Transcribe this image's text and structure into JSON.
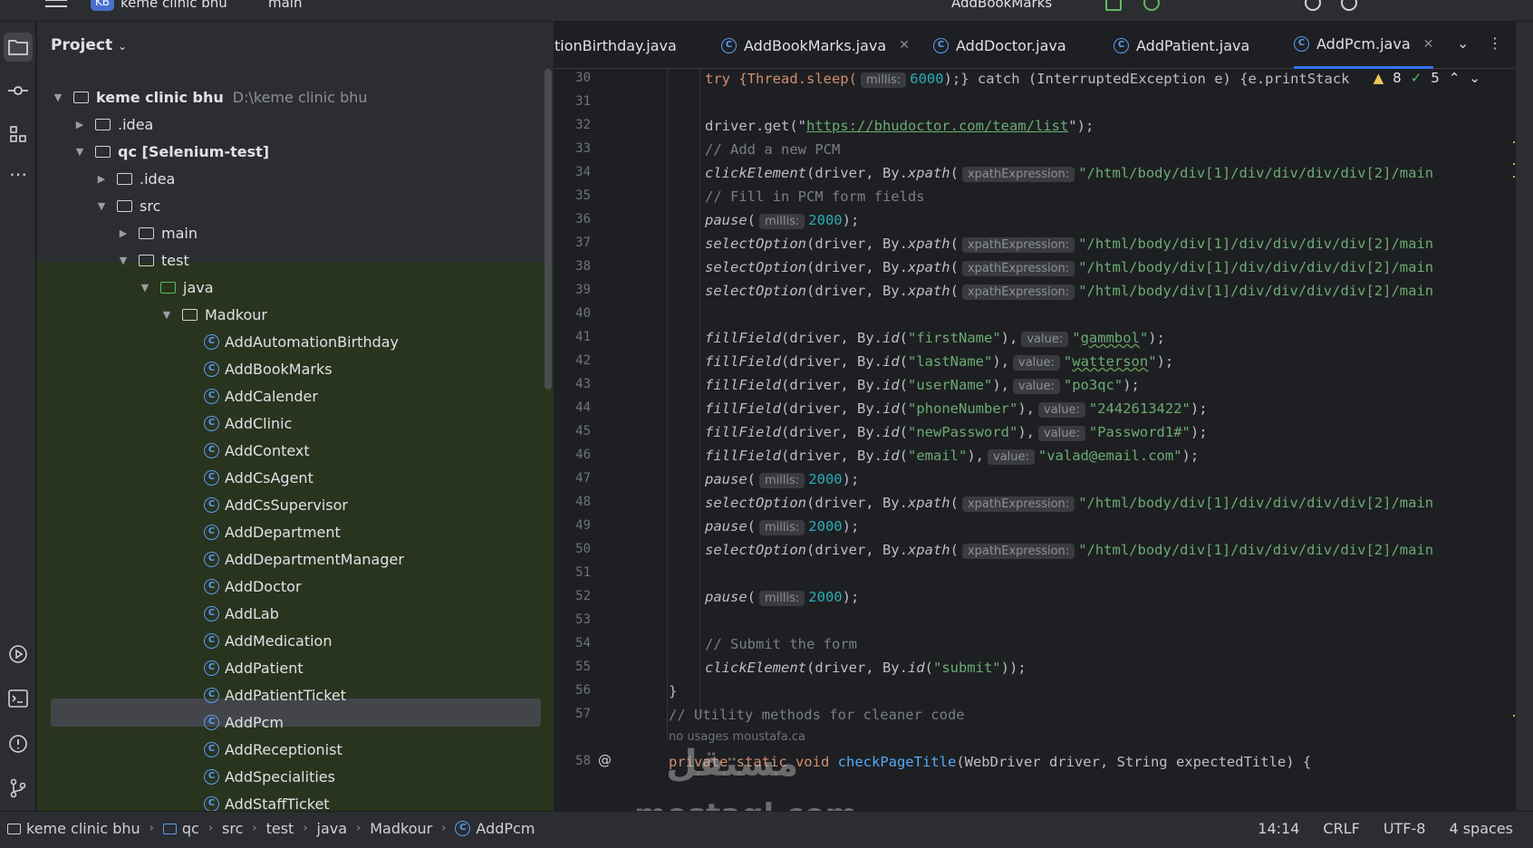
{
  "topbar": {
    "project_badge": "KB",
    "project_name": "keme clinic bhu",
    "branch": "main",
    "run_config": "AddBookMarks"
  },
  "project_panel": {
    "title": "Project",
    "tree": [
      {
        "label": "keme clinic bhu",
        "path": "D:\\keme clinic bhu"
      },
      {
        "label": ".idea"
      },
      {
        "label": "qc [Selenium-test]"
      },
      {
        "label": ".idea"
      },
      {
        "label": "src"
      },
      {
        "label": "main"
      },
      {
        "label": "test"
      },
      {
        "label": "java"
      },
      {
        "label": "Madkour"
      }
    ],
    "classes": [
      "AddAutomationBirthday",
      "AddBookMarks",
      "AddCalender",
      "AddClinic",
      "AddContext",
      "AddCsAgent",
      "AddCsSupervisor",
      "AddDepartment",
      "AddDepartmentManager",
      "AddDoctor",
      "AddLab",
      "AddMedication",
      "AddPatient",
      "AddPatientTicket",
      "AddPcm",
      "AddReceptionist",
      "AddSpecialities",
      "AddStaffTicket"
    ]
  },
  "tabs": [
    {
      "label": "tionBirthday.java"
    },
    {
      "label": "AddBookMarks.java"
    },
    {
      "label": "AddDoctor.java"
    },
    {
      "label": "AddPatient.java"
    },
    {
      "label": "AddPcm.java"
    }
  ],
  "inspections": {
    "warnings": "8",
    "ok": "5"
  },
  "code": {
    "l30": {
      "n": "30",
      "a": "try {Thread.sleep(",
      "hint": "millis:",
      "num": "6000",
      "b": ");} catch (InterruptedException e) {e.printStack"
    },
    "l31": {
      "n": "31"
    },
    "l32": {
      "n": "32",
      "a": "driver.get(\"",
      "url": "https://bhudoctor.com/team/list",
      "b": "\");"
    },
    "l33": {
      "n": "33",
      "cm": "// Add a new PCM"
    },
    "l34": {
      "n": "34",
      "m": "clickElement",
      "a": "(driver, By.",
      "m2": "xpath",
      "hint": "xpathExpression:",
      "s": "\"/html/body/div[1]/div/div/div/div[2]/main"
    },
    "l35": {
      "n": "35",
      "cm": "// Fill in PCM form fields"
    },
    "l36": {
      "n": "36",
      "m": "pause",
      "hint": "millis:",
      "num": "2000",
      "b": ");"
    },
    "l37": {
      "n": "37",
      "m": "selectOption",
      "a": "(driver, By.",
      "m2": "xpath",
      "hint": "xpathExpression:",
      "s": "\"/html/body/div[1]/div/div/div/div[2]/main"
    },
    "l38": {
      "n": "38",
      "m": "selectOption",
      "a": "(driver, By.",
      "m2": "xpath",
      "hint": "xpathExpression:",
      "s": "\"/html/body/div[1]/div/div/div/div[2]/main"
    },
    "l39": {
      "n": "39",
      "m": "selectOption",
      "a": "(driver, By.",
      "m2": "xpath",
      "hint": "xpathExpression:",
      "s": "\"/html/body/div[1]/div/div/div/div[2]/main"
    },
    "l40": {
      "n": "40"
    },
    "l41": {
      "n": "41",
      "m": "fillField",
      "a": "(driver, By.",
      "m2": "id",
      "s1": "\"firstName\"",
      "c": "),",
      "hint": "value:",
      "q1": "\"",
      "s2": "gammbol",
      "q2": "\"",
      "b": ");"
    },
    "l42": {
      "n": "42",
      "m": "fillField",
      "a": "(driver, By.",
      "m2": "id",
      "s1": "\"lastName\"",
      "c": "),",
      "hint": "value:",
      "q1": "\"",
      "s2": "watterson",
      "q2": "\"",
      "b": ");"
    },
    "l43": {
      "n": "43",
      "m": "fillField",
      "a": "(driver, By.",
      "m2": "id",
      "s1": "\"userName\"",
      "c": "),",
      "hint": "value:",
      "s2": "\"po3qc\"",
      "b": ");"
    },
    "l44": {
      "n": "44",
      "m": "fillField",
      "a": "(driver, By.",
      "m2": "id",
      "s1": "\"phoneNumber\"",
      "c": "),",
      "hint": "value:",
      "s2": "\"2442613422\"",
      "b": ");"
    },
    "l45": {
      "n": "45",
      "m": "fillField",
      "a": "(driver, By.",
      "m2": "id",
      "s1": "\"newPassword\"",
      "c": "),",
      "hint": "value:",
      "s2": "\"Password1#\"",
      "b": ");"
    },
    "l46": {
      "n": "46",
      "m": "fillField",
      "a": "(driver, By.",
      "m2": "id",
      "s1": "\"email\"",
      "c": "),",
      "hint": "value:",
      "s2": "\"valad@email.com\"",
      "b": ");"
    },
    "l47": {
      "n": "47",
      "m": "pause",
      "hint": "millis:",
      "num": "2000",
      "b": ");"
    },
    "l48": {
      "n": "48",
      "m": "selectOption",
      "a": "(driver, By.",
      "m2": "xpath",
      "hint": "xpathExpression:",
      "s": "\"/html/body/div[1]/div/div/div/div[2]/main"
    },
    "l49": {
      "n": "49",
      "m": "pause",
      "hint": "millis:",
      "num": "2000",
      "b": ");"
    },
    "l50": {
      "n": "50",
      "m": "selectOption",
      "a": "(driver, By.",
      "m2": "xpath",
      "hint": "xpathExpression:",
      "s": "\"/html/body/div[1]/div/div/div/div[2]/main"
    },
    "l51": {
      "n": "51"
    },
    "l52": {
      "n": "52",
      "m": "pause",
      "hint": "millis:",
      "num": "2000",
      "b": ");"
    },
    "l53": {
      "n": "53"
    },
    "l54": {
      "n": "54",
      "cm": "// Submit the form"
    },
    "l55": {
      "n": "55",
      "m": "clickElement",
      "a": "(driver, By.",
      "m2": "id",
      "s1": "\"submit\"",
      "b": "));"
    },
    "l56": {
      "n": "56",
      "a": "}"
    },
    "l57": {
      "n": "57",
      "cm": "// Utility methods for cleaner code"
    },
    "usage": "no usages   moustafa.ca",
    "l58": {
      "n": "58",
      "kw": "private static void",
      "m": "checkPageTitle",
      "a": "(WebDriver driver, String expectedTitle) {"
    }
  },
  "watermark": {
    "arabic": "مستقل",
    "latin": "mostaql.com"
  },
  "statusbar": {
    "breadcrumb": [
      "keme clinic bhu",
      "qc",
      "src",
      "test",
      "java",
      "Madkour",
      "AddPcm"
    ],
    "position": "14:14",
    "line_sep": "CRLF",
    "encoding": "UTF-8",
    "indent": "4 spaces"
  }
}
